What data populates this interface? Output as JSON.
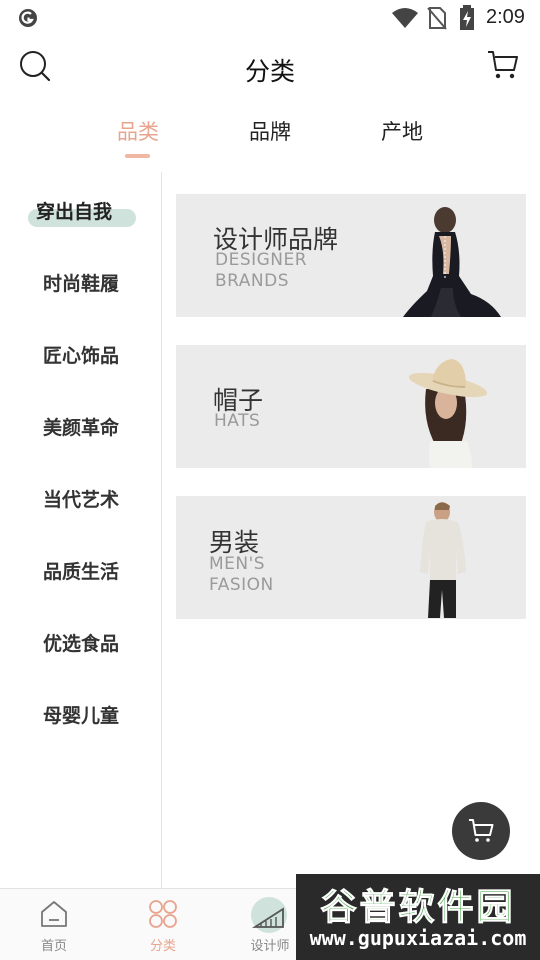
{
  "status_bar": {
    "time": "2:09"
  },
  "header": {
    "title": "分类"
  },
  "tabs": [
    {
      "label": "品类",
      "active": true
    },
    {
      "label": "品牌",
      "active": false
    },
    {
      "label": "产地",
      "active": false
    }
  ],
  "sidebar": {
    "items": [
      {
        "label": "穿出自我",
        "active": true
      },
      {
        "label": "时尚鞋履"
      },
      {
        "label": "匠心饰品"
      },
      {
        "label": "美颜革命"
      },
      {
        "label": "当代艺术"
      },
      {
        "label": "品质生活"
      },
      {
        "label": "优选食品"
      },
      {
        "label": "母婴儿童"
      }
    ]
  },
  "banners": [
    {
      "title": "设计师品牌",
      "subtitle_line1": "DESIGNER",
      "subtitle_line2": "BRANDS"
    },
    {
      "title": "帽子",
      "subtitle_line1": "HATS",
      "subtitle_line2": ""
    },
    {
      "title": "男装",
      "subtitle_line1": "MEN'S",
      "subtitle_line2": "FASION"
    }
  ],
  "bottom_nav": {
    "items": [
      {
        "label": "首页",
        "icon": "home-icon"
      },
      {
        "label": "分类",
        "icon": "category-icon",
        "active": true
      },
      {
        "label": "设计师",
        "icon": "designer-icon"
      }
    ]
  },
  "watermark": {
    "name": "谷普软件园",
    "url": "www.gupuxiazai.com"
  },
  "colors": {
    "accent": "#e8a48f",
    "pill": "#cfe2dc",
    "banner_bg": "#ebebec",
    "fab": "#3a3a3a"
  }
}
